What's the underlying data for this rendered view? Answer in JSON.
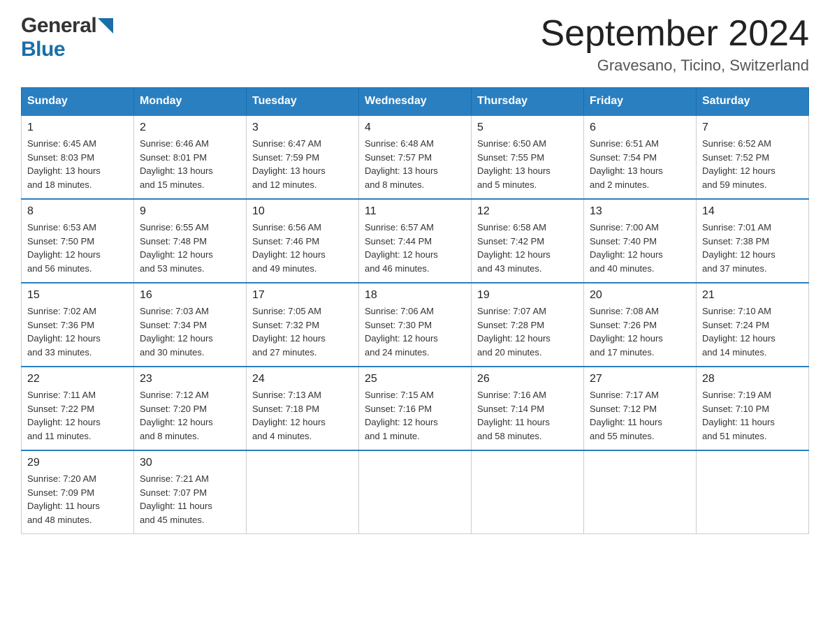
{
  "header": {
    "logo": {
      "general_text": "General",
      "blue_text": "Blue"
    },
    "title": "September 2024",
    "location": "Gravesano, Ticino, Switzerland"
  },
  "calendar": {
    "columns": [
      "Sunday",
      "Monday",
      "Tuesday",
      "Wednesday",
      "Thursday",
      "Friday",
      "Saturday"
    ],
    "weeks": [
      [
        {
          "day": "1",
          "info": "Sunrise: 6:45 AM\nSunset: 8:03 PM\nDaylight: 13 hours\nand 18 minutes."
        },
        {
          "day": "2",
          "info": "Sunrise: 6:46 AM\nSunset: 8:01 PM\nDaylight: 13 hours\nand 15 minutes."
        },
        {
          "day": "3",
          "info": "Sunrise: 6:47 AM\nSunset: 7:59 PM\nDaylight: 13 hours\nand 12 minutes."
        },
        {
          "day": "4",
          "info": "Sunrise: 6:48 AM\nSunset: 7:57 PM\nDaylight: 13 hours\nand 8 minutes."
        },
        {
          "day": "5",
          "info": "Sunrise: 6:50 AM\nSunset: 7:55 PM\nDaylight: 13 hours\nand 5 minutes."
        },
        {
          "day": "6",
          "info": "Sunrise: 6:51 AM\nSunset: 7:54 PM\nDaylight: 13 hours\nand 2 minutes."
        },
        {
          "day": "7",
          "info": "Sunrise: 6:52 AM\nSunset: 7:52 PM\nDaylight: 12 hours\nand 59 minutes."
        }
      ],
      [
        {
          "day": "8",
          "info": "Sunrise: 6:53 AM\nSunset: 7:50 PM\nDaylight: 12 hours\nand 56 minutes."
        },
        {
          "day": "9",
          "info": "Sunrise: 6:55 AM\nSunset: 7:48 PM\nDaylight: 12 hours\nand 53 minutes."
        },
        {
          "day": "10",
          "info": "Sunrise: 6:56 AM\nSunset: 7:46 PM\nDaylight: 12 hours\nand 49 minutes."
        },
        {
          "day": "11",
          "info": "Sunrise: 6:57 AM\nSunset: 7:44 PM\nDaylight: 12 hours\nand 46 minutes."
        },
        {
          "day": "12",
          "info": "Sunrise: 6:58 AM\nSunset: 7:42 PM\nDaylight: 12 hours\nand 43 minutes."
        },
        {
          "day": "13",
          "info": "Sunrise: 7:00 AM\nSunset: 7:40 PM\nDaylight: 12 hours\nand 40 minutes."
        },
        {
          "day": "14",
          "info": "Sunrise: 7:01 AM\nSunset: 7:38 PM\nDaylight: 12 hours\nand 37 minutes."
        }
      ],
      [
        {
          "day": "15",
          "info": "Sunrise: 7:02 AM\nSunset: 7:36 PM\nDaylight: 12 hours\nand 33 minutes."
        },
        {
          "day": "16",
          "info": "Sunrise: 7:03 AM\nSunset: 7:34 PM\nDaylight: 12 hours\nand 30 minutes."
        },
        {
          "day": "17",
          "info": "Sunrise: 7:05 AM\nSunset: 7:32 PM\nDaylight: 12 hours\nand 27 minutes."
        },
        {
          "day": "18",
          "info": "Sunrise: 7:06 AM\nSunset: 7:30 PM\nDaylight: 12 hours\nand 24 minutes."
        },
        {
          "day": "19",
          "info": "Sunrise: 7:07 AM\nSunset: 7:28 PM\nDaylight: 12 hours\nand 20 minutes."
        },
        {
          "day": "20",
          "info": "Sunrise: 7:08 AM\nSunset: 7:26 PM\nDaylight: 12 hours\nand 17 minutes."
        },
        {
          "day": "21",
          "info": "Sunrise: 7:10 AM\nSunset: 7:24 PM\nDaylight: 12 hours\nand 14 minutes."
        }
      ],
      [
        {
          "day": "22",
          "info": "Sunrise: 7:11 AM\nSunset: 7:22 PM\nDaylight: 12 hours\nand 11 minutes."
        },
        {
          "day": "23",
          "info": "Sunrise: 7:12 AM\nSunset: 7:20 PM\nDaylight: 12 hours\nand 8 minutes."
        },
        {
          "day": "24",
          "info": "Sunrise: 7:13 AM\nSunset: 7:18 PM\nDaylight: 12 hours\nand 4 minutes."
        },
        {
          "day": "25",
          "info": "Sunrise: 7:15 AM\nSunset: 7:16 PM\nDaylight: 12 hours\nand 1 minute."
        },
        {
          "day": "26",
          "info": "Sunrise: 7:16 AM\nSunset: 7:14 PM\nDaylight: 11 hours\nand 58 minutes."
        },
        {
          "day": "27",
          "info": "Sunrise: 7:17 AM\nSunset: 7:12 PM\nDaylight: 11 hours\nand 55 minutes."
        },
        {
          "day": "28",
          "info": "Sunrise: 7:19 AM\nSunset: 7:10 PM\nDaylight: 11 hours\nand 51 minutes."
        }
      ],
      [
        {
          "day": "29",
          "info": "Sunrise: 7:20 AM\nSunset: 7:09 PM\nDaylight: 11 hours\nand 48 minutes."
        },
        {
          "day": "30",
          "info": "Sunrise: 7:21 AM\nSunset: 7:07 PM\nDaylight: 11 hours\nand 45 minutes."
        },
        {
          "day": "",
          "info": ""
        },
        {
          "day": "",
          "info": ""
        },
        {
          "day": "",
          "info": ""
        },
        {
          "day": "",
          "info": ""
        },
        {
          "day": "",
          "info": ""
        }
      ]
    ]
  }
}
